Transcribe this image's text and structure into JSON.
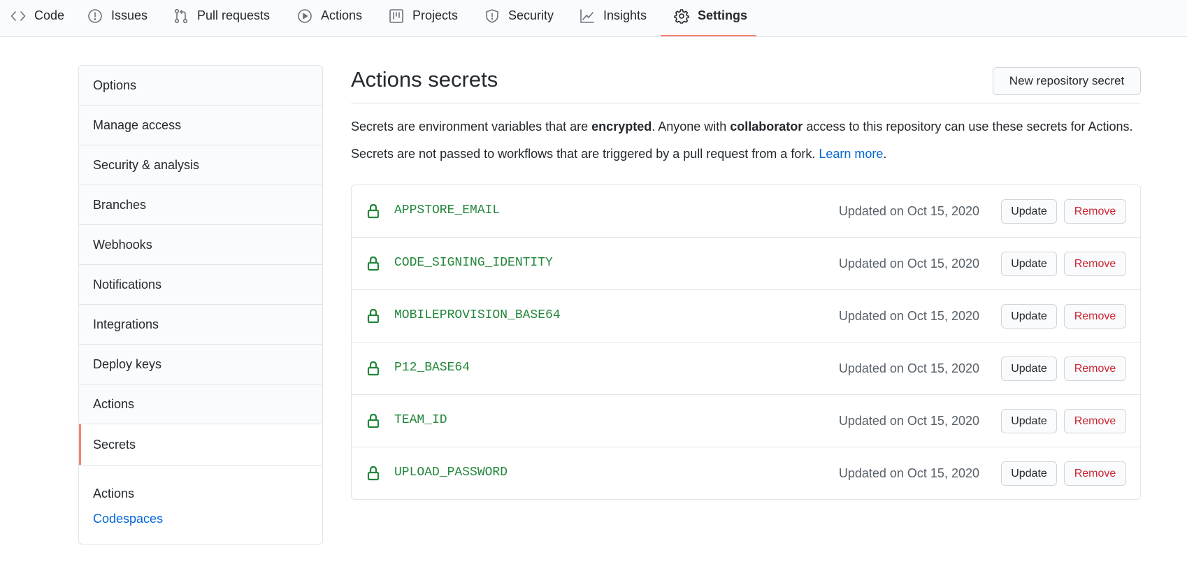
{
  "tabs": [
    {
      "label": "Code",
      "icon": "code-icon"
    },
    {
      "label": "Issues",
      "icon": "issue-icon"
    },
    {
      "label": "Pull requests",
      "icon": "pull-request-icon"
    },
    {
      "label": "Actions",
      "icon": "play-icon"
    },
    {
      "label": "Projects",
      "icon": "project-icon"
    },
    {
      "label": "Security",
      "icon": "shield-icon"
    },
    {
      "label": "Insights",
      "icon": "graph-icon"
    },
    {
      "label": "Settings",
      "icon": "gear-icon",
      "selected": true
    }
  ],
  "sidebar": {
    "items": [
      {
        "label": "Options"
      },
      {
        "label": "Manage access"
      },
      {
        "label": "Security & analysis"
      },
      {
        "label": "Branches"
      },
      {
        "label": "Webhooks"
      },
      {
        "label": "Notifications"
      },
      {
        "label": "Integrations"
      },
      {
        "label": "Deploy keys"
      },
      {
        "label": "Actions"
      },
      {
        "label": "Secrets",
        "selected": true
      }
    ],
    "sub_items": [
      {
        "label": "Actions"
      },
      {
        "label": "Codespaces"
      }
    ]
  },
  "main": {
    "title": "Actions secrets",
    "new_secret_label": "New repository secret",
    "desc1": {
      "part1": "Secrets are environment variables that are ",
      "bold1": "encrypted",
      "part2": ". Anyone with ",
      "bold2": "collaborator",
      "part3": " access to this repository can use these secrets for Actions."
    },
    "desc2": {
      "text": "Secrets are not passed to workflows that are triggered by a pull request from a fork. ",
      "link": "Learn more",
      "end": "."
    },
    "update_label": "Update",
    "remove_label": "Remove",
    "secrets": [
      {
        "name": "APPSTORE_EMAIL",
        "updated": "Updated on Oct 15, 2020"
      },
      {
        "name": "CODE_SIGNING_IDENTITY",
        "updated": "Updated on Oct 15, 2020"
      },
      {
        "name": "MOBILEPROVISION_BASE64",
        "updated": "Updated on Oct 15, 2020"
      },
      {
        "name": "P12_BASE64",
        "updated": "Updated on Oct 15, 2020"
      },
      {
        "name": "TEAM_ID",
        "updated": "Updated on Oct 15, 2020"
      },
      {
        "name": "UPLOAD_PASSWORD",
        "updated": "Updated on Oct 15, 2020"
      }
    ]
  },
  "colors": {
    "accent": "#f9826c",
    "link": "#0366d6",
    "secret_green": "#22863a",
    "danger": "#cb2431"
  }
}
